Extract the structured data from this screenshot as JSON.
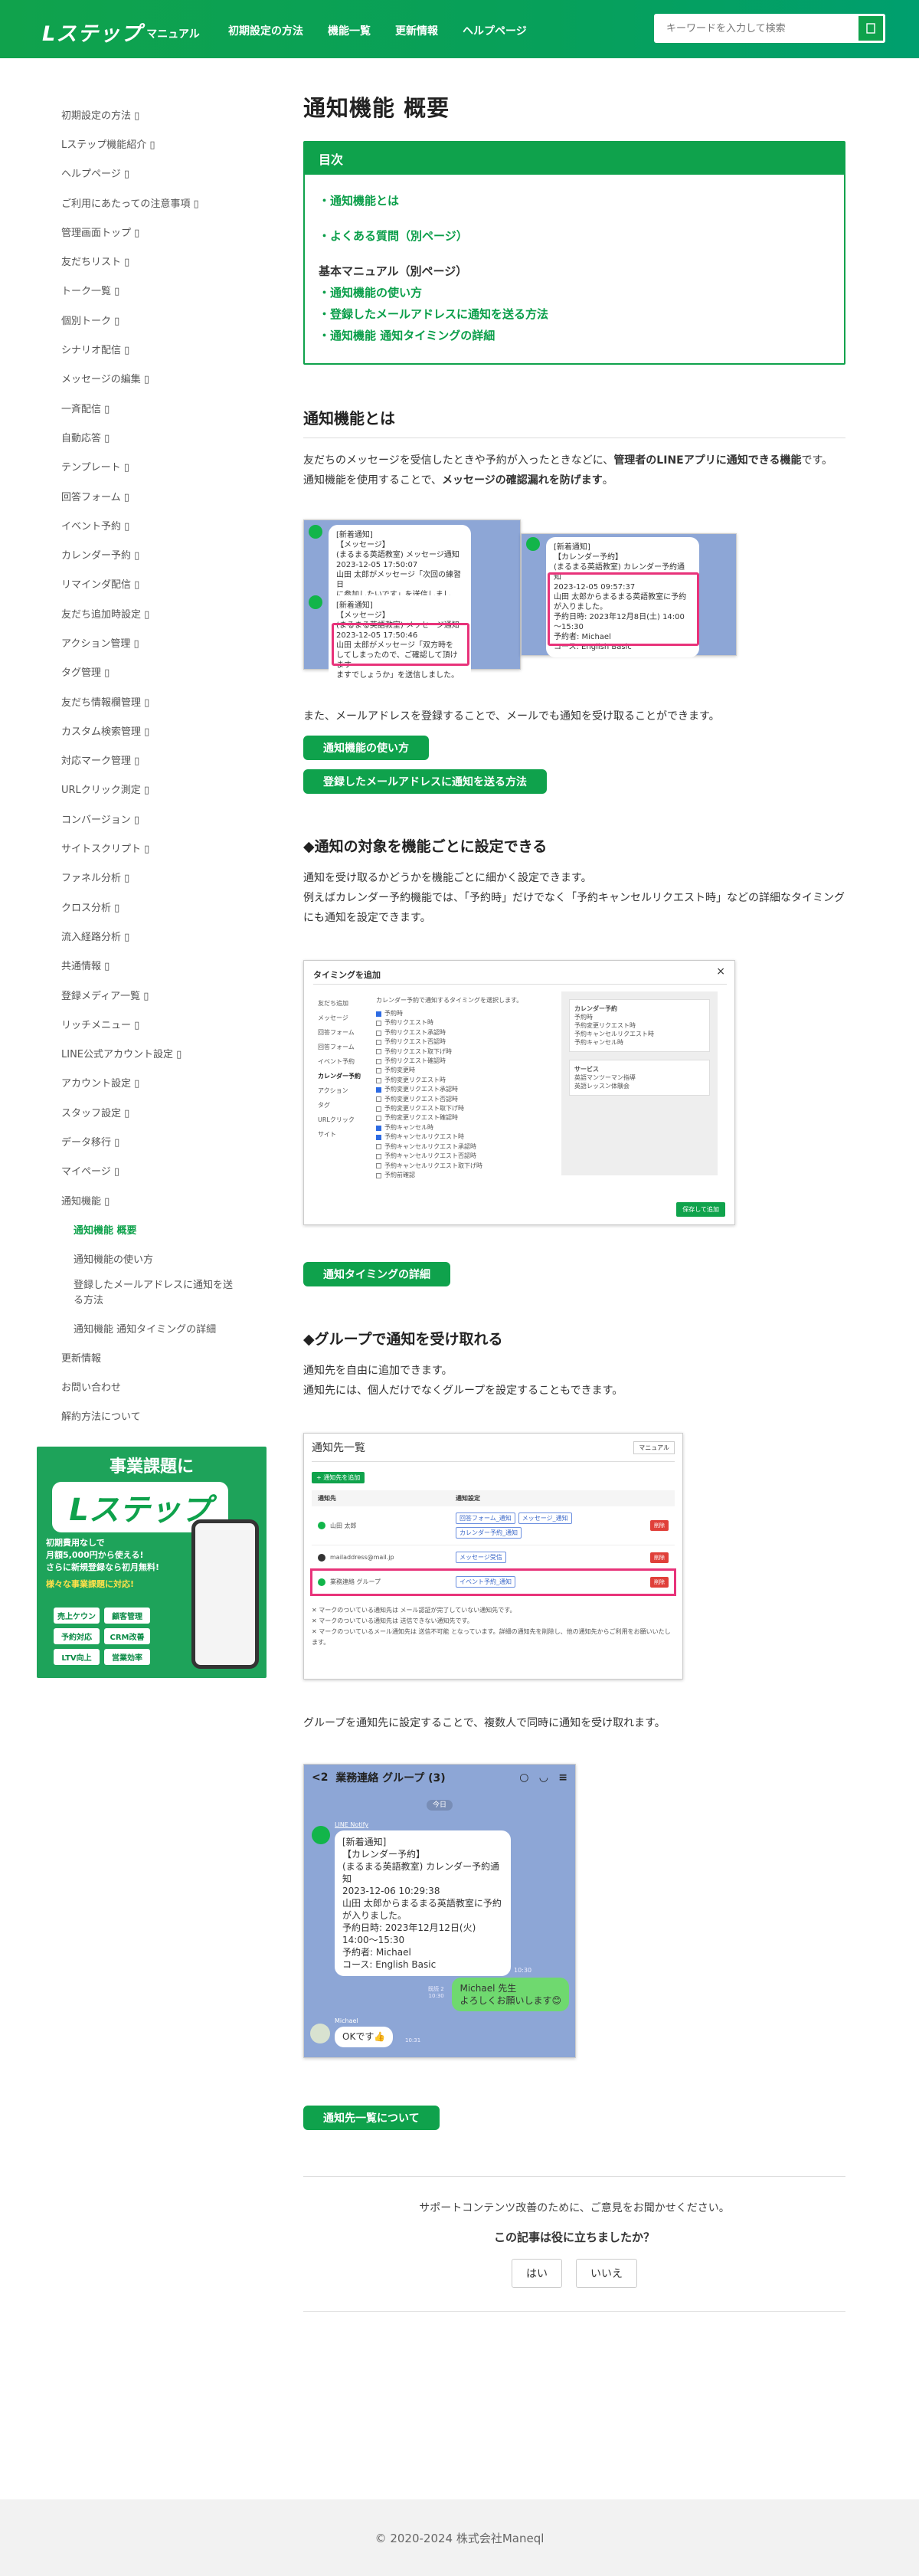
{
  "header": {
    "logo_text": "Lステップ",
    "logo_sub": "マニュアル",
    "nav": [
      "初期設定の方法",
      "機能一覧",
      "更新情報",
      "ヘルプページ"
    ],
    "search_placeholder": "キーワードを入力して検索"
  },
  "sidebar": {
    "items": [
      "初期設定の方法",
      "Lステップ機能紹介",
      "ヘルプページ",
      "ご利用にあたっての注意事項",
      "管理画面トップ",
      "友だちリスト",
      "トーク一覧",
      "個別トーク",
      "シナリオ配信",
      "メッセージの編集",
      "一斉配信",
      "自動応答",
      "テンプレート",
      "回答フォーム",
      "イベント予約",
      "カレンダー予約",
      "リマインダ配信",
      "友だち追加時設定",
      "アクション管理",
      "タグ管理",
      "友だち情報欄管理",
      "カスタム検索管理",
      "対応マーク管理",
      "URLクリック測定",
      "コンバージョン",
      "サイトスクリプト",
      "ファネル分析",
      "クロス分析",
      "流入経路分析",
      "共通情報",
      "登録メディア一覧",
      "リッチメニュー",
      "LINE公式アカウント設定",
      "アカウント設定",
      "スタッフ設定",
      "データ移行",
      "マイページ",
      "通知機能"
    ],
    "sub_items": [
      "通知機能 概要",
      "通知機能の使い方",
      "登録したメールアドレスに通知を送る方法",
      "通知機能 通知タイミングの詳細"
    ],
    "tail_items": [
      "更新情報",
      "お問い合わせ",
      "解約方法について"
    ],
    "arrow": "▯"
  },
  "banner": {
    "headline": "事業課題に",
    "brand": "Lステップ",
    "line1": "初期費用なしで",
    "line2": "月額5,000円から使える!",
    "line3": "さらに新規登録なら初月無料!",
    "line4": "様々な事業課題に対応!",
    "chips": [
      "売上ケウン",
      "顧客管理",
      "予約対応",
      "CRM改善",
      "LTV向上",
      "営業効率"
    ]
  },
  "main": {
    "title": "通知機能 概要",
    "toc": {
      "heading": "目次",
      "links": [
        "・通知機能とは",
        "・よくある質問（別ページ）"
      ],
      "label": "基本マニュアル（別ページ）",
      "sublinks": [
        "・通知機能の使い方",
        "・登録したメールアドレスに通知を送る方法",
        "・通知機能 通知タイミングの詳細"
      ]
    },
    "section1": {
      "heading": "通知機能とは",
      "p1a": "友だちのメッセージを受信したときや予約が入ったときなどに、",
      "p1b": "管理者のLINEアプリに通知できる機能",
      "p1c": "です。",
      "p2a": "通知機能を使用することで、",
      "p2b": "メッセージの確認漏れを防げます",
      "p2c": "。",
      "p3": "また、メールアドレスを登録することで、メールでも通知を受け取ることができます。",
      "btn1": "通知機能の使い方",
      "btn2": "登録したメールアドレスに通知を送る方法"
    },
    "chat1": {
      "b1": [
        "[新着通知]",
        "【メッセージ】",
        "(まるまる英語教室) メッセージ通知",
        "2023-12-05 17:50:07",
        "山田 太郎がメッセージ「次回の練習日",
        "に参加したいです」を送信しました。"
      ],
      "b2": [
        "[新着通知]",
        "【メッセージ】",
        "(まるまる英語教室) メッセージ通知",
        "2023-12-05 17:50:46",
        "山田 太郎がメッセージ「双方時を",
        "してしまったので、ご確認して頂けます",
        "ますでしょうか」を送信しました。"
      ],
      "b3": [
        "[新着通知]",
        "【カレンダー予約】",
        "(まるまる英語教室) カレンダー予約通",
        "知",
        "2023-12-05 09:57:37",
        "山田 太郎からまるまる英語教室に予約",
        "が入りました。",
        "予約日時: 2023年12月8日(土) 14:00",
        "～15:30",
        "予約者: Michael",
        "コース: English Basic"
      ]
    },
    "section2": {
      "heading": "◆通知の対象を機能ごとに設定できる",
      "p1": "通知を受け取るかどうかを機能ごとに細かく設定できます。",
      "p2": "例えばカレンダー予約機能では、「予約時」だけでなく「予約キャンセルリクエスト時」などの詳細なタイミングにも通知を設定できます。",
      "btn": "通知タイミングの詳細"
    },
    "timing_modal": {
      "title": "タイミングを追加",
      "close": "×",
      "left_menu": [
        "友だち追加",
        "メッセージ",
        "回答フォーム",
        "回答フォーム",
        "イベント予約",
        "カレンダー予約",
        "アクション",
        "タグ",
        "URLクリック",
        "サイト"
      ],
      "note": "カレンダー予約で通知するタイミングを選択します。",
      "checks": [
        "予約時",
        "予約リクエスト時",
        "予約リクエスト承認時",
        "予約リクエスト否認時",
        "予約リクエスト取下げ時",
        "予約リクエスト確認時",
        "予約変更時",
        "予約変更リクエスト時",
        "予約変更リクエスト承認時",
        "予約変更リクエスト否認時",
        "予約変更リクエスト取下げ時",
        "予約変更リクエスト確認時",
        "予約キャンセル時",
        "予約キャンセルリクエスト時",
        "予約キャンセルリクエスト承認時",
        "予約キャンセルリクエスト否認時",
        "予約キャンセルリクエスト取下げ時",
        "予約前確認"
      ],
      "side1_title": "カレンダー予約",
      "side1_lines": [
        "予約時",
        "予約変更リクエスト時",
        "予約キャンセルリクエスト時",
        "予約キャンセル時"
      ],
      "side2_title": "サービス",
      "side2_lines": [
        "英語マンツーマン指導",
        "英語レッスン体験会"
      ],
      "confirm": "保存して追加"
    },
    "section3": {
      "heading": "◆グループで通知を受け取れる",
      "p1": "通知先を自由に追加できます。",
      "p2": "通知先には、個人だけでなくグループを設定することもできます。",
      "p3": "グループを通知先に設定することで、複数人で同時に通知を受け取れます。",
      "btn": "通知先一覧について"
    },
    "notify_list": {
      "title": "通知先一覧",
      "manual_btn": "マニュアル",
      "add_btn": "+ 通知先を追加",
      "headers": [
        "通知先",
        "通知設定"
      ],
      "rows": [
        {
          "name": "山田 太郎",
          "tags": [
            "回答フォーム_通知",
            "メッセージ_通知",
            "カレンダー予約_通知"
          ],
          "del": "削除"
        },
        {
          "name": "mailaddress@mail.jp",
          "tags": [
            "メッセージ受信"
          ],
          "del": "削除"
        },
        {
          "name": "業務連絡 グループ",
          "tags": [
            "イベント予約_通知"
          ],
          "del": "削除"
        }
      ],
      "notes": [
        "マークのついている通知先は メール認証が完了していない通知先です。",
        "マークのついている通知先は 送信できない通知先です。",
        "マークのついているメール通知先は 送信不可能 となっています。詳細の通知先を削除し、他の通知先からご利用をお願いいたします。"
      ]
    },
    "group_chat": {
      "back": "2",
      "title": "業務連絡 グループ (3)",
      "today": "今日",
      "sender": "LINE Notify",
      "lines": [
        "[新着通知]",
        "【カレンダー予約】",
        "(まるまる英語教室) カレンダー予約通",
        "知",
        "2023-12-06 10:29:38",
        "山田 太郎からまるまる英語教室に予約",
        "が入りました。",
        "予約日時: 2023年12月12日(火)",
        "14:00～15:30",
        "予約者: Michael",
        "コース: English Basic"
      ],
      "time1": "10:30",
      "reply1": [
        "Michael 先生",
        "よろしくお願いします😊"
      ],
      "read": "既読 2",
      "time2": "10:30",
      "michael": "Michael",
      "reply2": "OKです👍",
      "time3": "10:31"
    },
    "feedback": {
      "q1": "サポートコンテンツ改善のために、ご意見をお聞かせください。",
      "q2": "この記事は役に立ちましたか？",
      "yes": "はい",
      "no": "いいえ"
    }
  },
  "footer": {
    "copyright": "© 2020-2024 株式会社Maneql"
  }
}
